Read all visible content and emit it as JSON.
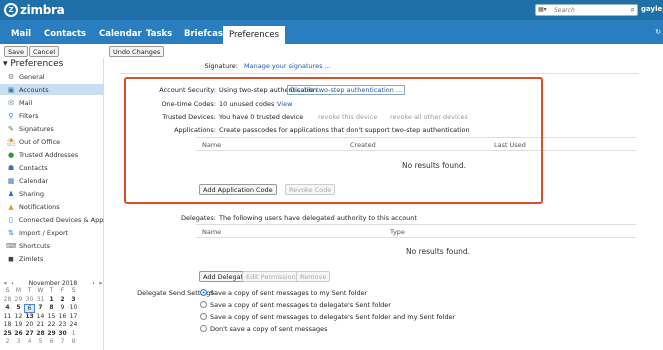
{
  "app": {
    "logo_text": "zimbra",
    "user": "gayle"
  },
  "search": {
    "placeholder": "Search"
  },
  "tabs": [
    {
      "label": "Mail"
    },
    {
      "label": "Contacts"
    },
    {
      "label": "Calendar"
    },
    {
      "label": "Tasks"
    },
    {
      "label": "Briefcase"
    },
    {
      "label": "Preferences"
    }
  ],
  "toolbar": {
    "save": "Save",
    "cancel": "Cancel",
    "undo": "Undo Changes"
  },
  "sidebar": {
    "header": "Preferences",
    "items": [
      {
        "label": "General",
        "icon": "gear-icon"
      },
      {
        "label": "Accounts",
        "icon": "accounts-icon"
      },
      {
        "label": "Mail",
        "icon": "mail-icon"
      },
      {
        "label": "Filters",
        "icon": "filter-icon"
      },
      {
        "label": "Signatures",
        "icon": "signature-icon"
      },
      {
        "label": "Out of Office",
        "icon": "out-of-office-icon"
      },
      {
        "label": "Trusted Addresses",
        "icon": "trusted-addresses-icon"
      },
      {
        "label": "Contacts",
        "icon": "contacts-icon"
      },
      {
        "label": "Calendar",
        "icon": "calendar-icon"
      },
      {
        "label": "Sharing",
        "icon": "sharing-icon"
      },
      {
        "label": "Notifications",
        "icon": "notifications-icon"
      },
      {
        "label": "Connected Devices & Apps",
        "icon": "devices-icon"
      },
      {
        "label": "Import / Export",
        "icon": "import-export-icon"
      },
      {
        "label": "Shortcuts",
        "icon": "shortcuts-icon"
      },
      {
        "label": "Zimlets",
        "icon": "zimlets-icon"
      }
    ]
  },
  "calendar": {
    "month": "November 2018",
    "dow": [
      "S",
      "M",
      "T",
      "W",
      "T",
      "F",
      "S"
    ],
    "weeks": [
      [
        "28",
        "29",
        "30",
        "31",
        "1",
        "2",
        "3"
      ],
      [
        "4",
        "5",
        "6",
        "7",
        "8",
        "9",
        "10"
      ],
      [
        "11",
        "12",
        "13",
        "14",
        "15",
        "16",
        "17"
      ],
      [
        "18",
        "19",
        "20",
        "21",
        "22",
        "23",
        "24"
      ],
      [
        "25",
        "26",
        "27",
        "28",
        "29",
        "30",
        "1"
      ],
      [
        "2",
        "3",
        "4",
        "5",
        "6",
        "7",
        "8"
      ]
    ]
  },
  "signature": {
    "label": "Signature:",
    "link": "Manage your signatures ..."
  },
  "security": {
    "account_label": "Account Security:",
    "account_text": "Using two-step authentication",
    "disable_link": "Disable two-step authentication ...",
    "codes_label": "One-time Codes:",
    "codes_text": "10 unused codes",
    "codes_view": "View",
    "trusted_label": "Trusted Devices:",
    "trusted_text": "You have 0 trusted device",
    "revoke_this": "revoke this device",
    "revoke_all": "revoke all other devices",
    "apps_label": "Applications:",
    "apps_text": "Create passcodes for applications that don't support two-step authentication",
    "cols": [
      "Name",
      "Created",
      "Last Used"
    ],
    "no_results": "No results found.",
    "add_code": "Add Application Code",
    "revoke_code": "Revoke Code"
  },
  "delegates": {
    "label": "Delegates:",
    "text": "The following users have delegated authority to this account",
    "cols": [
      "Name",
      "Type"
    ],
    "no_results": "No results found.",
    "add": "Add Delegate",
    "edit": "Edit Permissions",
    "remove": "Remove"
  },
  "send_settings": {
    "label": "Delegate Send Settings:",
    "options": [
      "Save a copy of sent messages to my Sent folder",
      "Save a copy of sent messages to delegate's Sent folder",
      "Save a copy of sent messages to delegate's Sent folder and my Sent folder",
      "Don't save a copy of sent messages"
    ],
    "selected": 0
  },
  "colors": {
    "topbar": "#1f6fa8",
    "appbar": "#2a7ec0",
    "highlight": "#d6502b",
    "link": "#1a5ea8"
  }
}
